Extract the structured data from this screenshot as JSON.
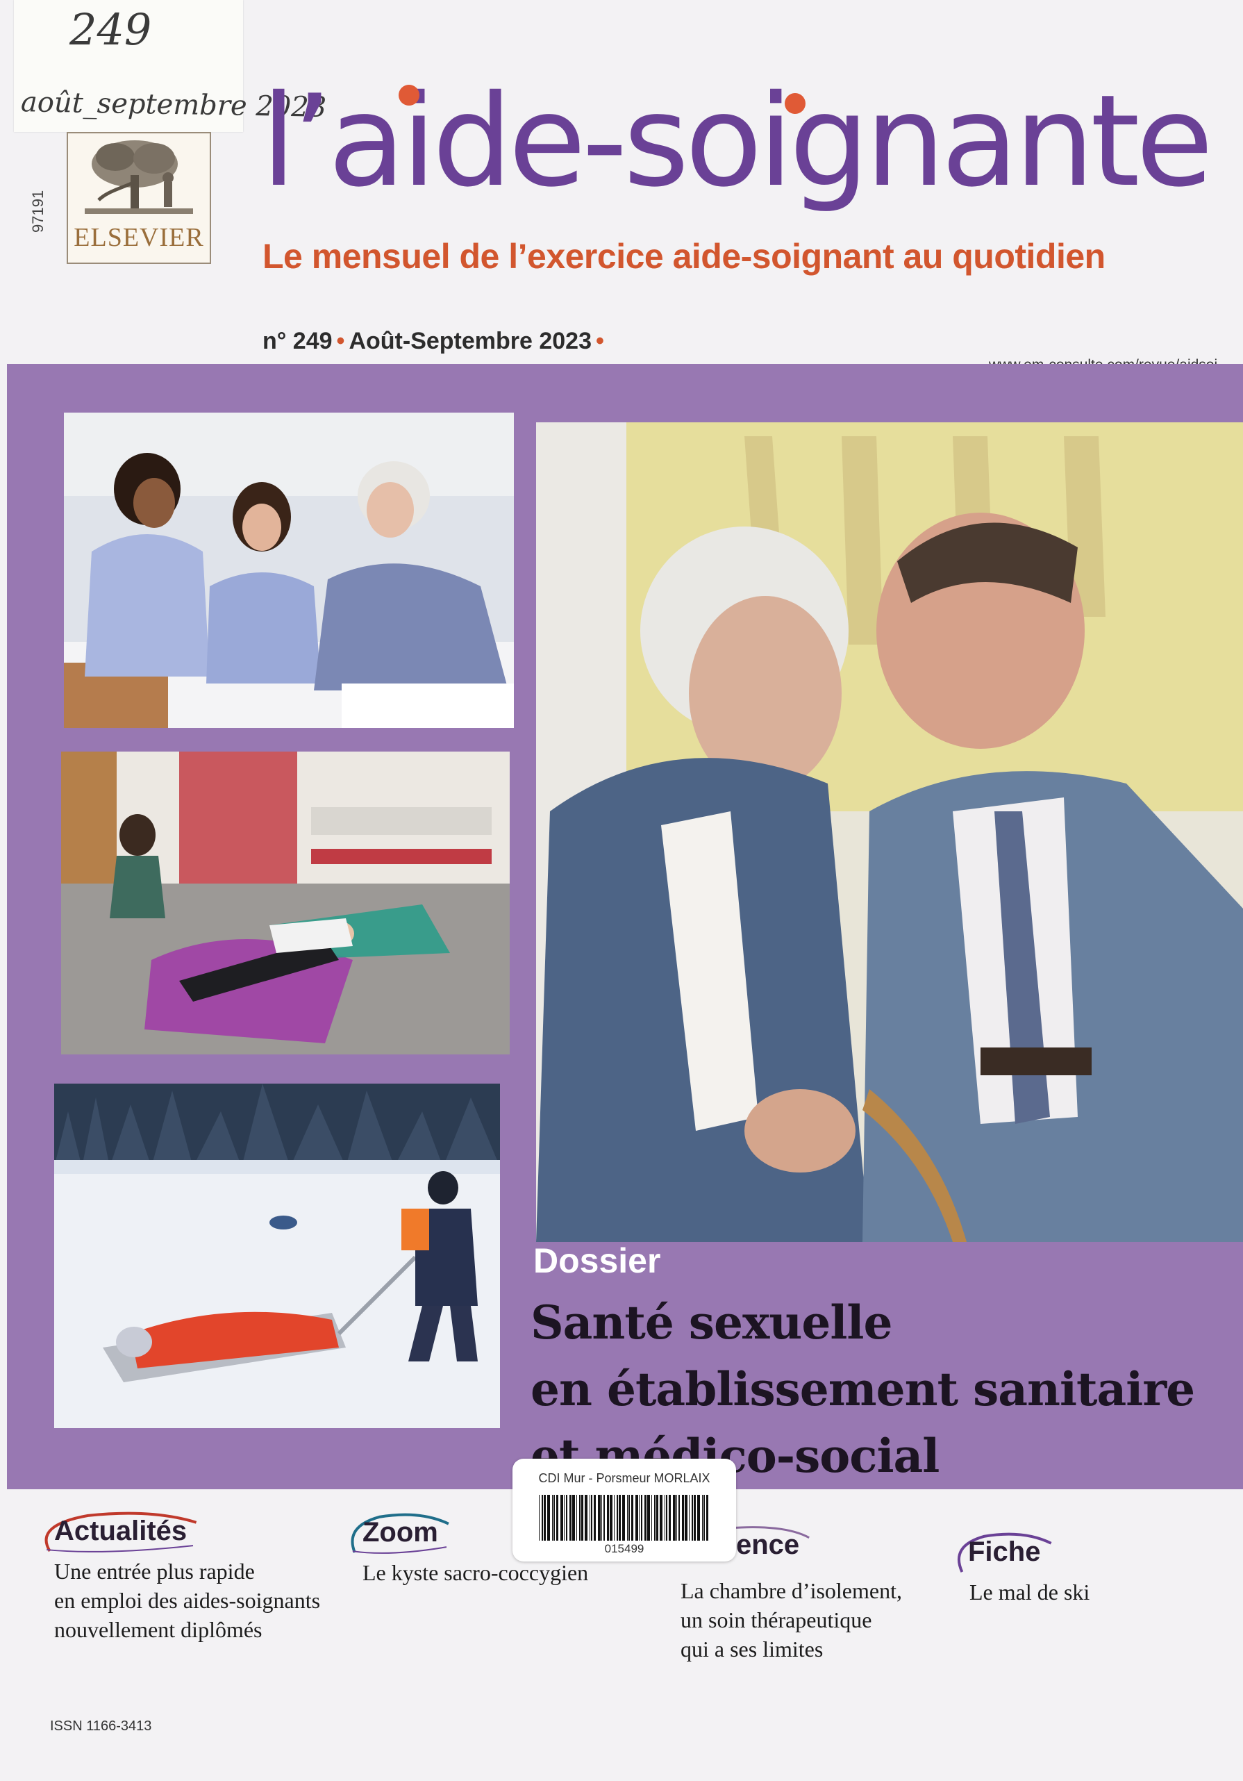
{
  "handwriting": {
    "number": "249",
    "date": "août_septembre 2023"
  },
  "publisher": {
    "name": "ELSEVIER",
    "side_code": "97191"
  },
  "masthead": {
    "title": "l’aide-soignante",
    "subtitle": "Le mensuel de l’exercice aide-soignant au quotidien",
    "issue": "n° 249",
    "date": "Août-Septembre 2023",
    "website": "www.em-consulte.com/revue/aidsoi"
  },
  "colors": {
    "brand_purple": "#6a4196",
    "accent_orange": "#d2562e",
    "band_purple": "#9878b2"
  },
  "dossier": {
    "label": "Dossier",
    "lines": [
      "Santé sexuelle",
      "en établissement sanitaire",
      "et médico-social"
    ]
  },
  "sticker": {
    "library": "CDI Mur - Porsmeur MORLAIX",
    "number": "015499"
  },
  "rubrics": [
    {
      "label": "Actualités",
      "lines": [
        "Une entrée plus rapide",
        "en emploi des aides-soignants",
        "nouvellement diplômés"
      ]
    },
    {
      "label": "Zoom",
      "lines": [
        "Le kyste sacro-coccygien"
      ]
    },
    {
      "label": "ence",
      "lines": [
        "La chambre d’isolement,",
        "un soin thérapeutique",
        "qui a ses limites"
      ]
    },
    {
      "label": "Fiche",
      "lines": [
        "Le mal de ski"
      ]
    }
  ],
  "issn": "ISSN 1166-3413"
}
